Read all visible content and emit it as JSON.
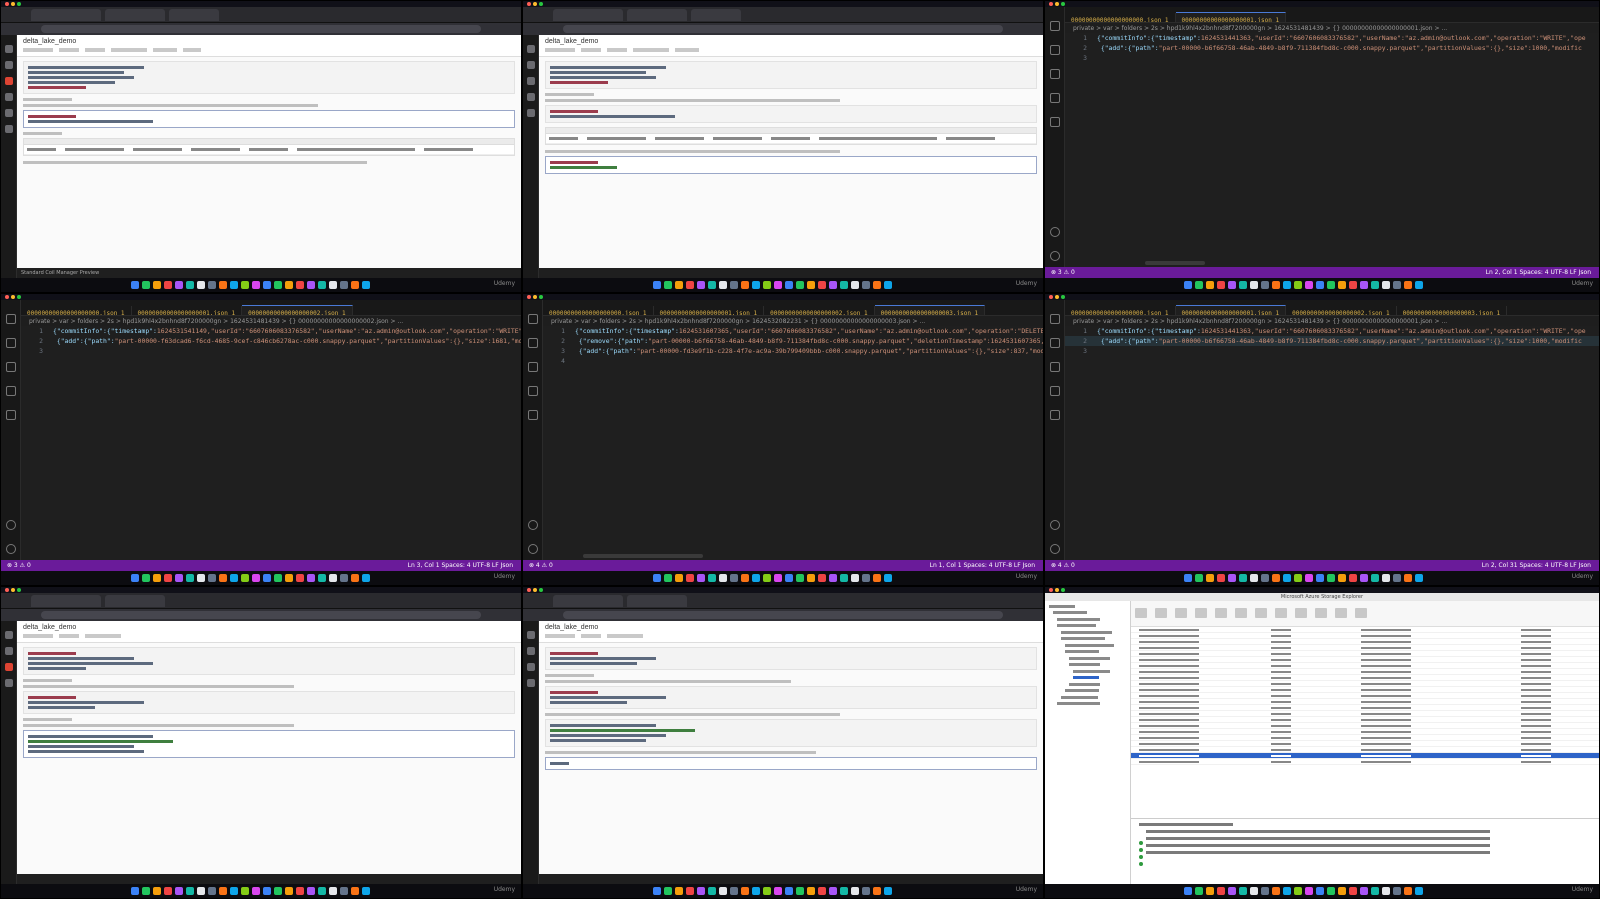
{
  "layout": "3x3 screen recording grid",
  "dock": {
    "label": "Udemy"
  },
  "notebooks": [
    {
      "title": "delta_lake_demo",
      "footer": "Insert cell",
      "status": "Standard Coil Manager Preview"
    },
    {
      "title": "delta_lake_demo",
      "footer": "Insert cell"
    },
    {
      "title": "delta_lake_demo",
      "footer": "Insert cell"
    },
    {
      "title": "delta_lake_demo",
      "footer": "Insert cell"
    }
  ],
  "editors": [
    {
      "tabs": [
        "00000000000000000000.json 1",
        "00000000000000000001.json 1"
      ],
      "selected": 1,
      "breadcrumb": "private > var > folders > 2s > hpd1k9hl4x2bnhnd8f7200000gn > 1624531481439 > {} 00000000000000000001.json > ...",
      "lines": [
        {
          "n": "1",
          "k": "{\"commitInfo\":{\"timestamp\":",
          "s": "1624531441363,\"userId\":\"6607606083376582\",\"userName\":\"az.admin@outlook.com\",\"operation\":\"WRITE\",\"ope"
        },
        {
          "n": "2",
          "k": " {\"add\":{\"path\":",
          "s": "\"part-00000-b6f66758-46ab-4849-b8f9-711384fbd8c-c000.snappy.parquet\",\"partitionValues\":{},\"size\":1000,\"modific"
        },
        {
          "n": "3",
          "k": "",
          "s": ""
        }
      ],
      "status_left": "⊗ 3 ⚠ 0",
      "status_right": "Ln 2, Col 1   Spaces: 4   UTF-8   LF   Json"
    },
    {
      "tabs": [
        "00000000000000000000.json 1",
        "00000000000000000001.json 1",
        "00000000000000000002.json 1"
      ],
      "selected": 2,
      "breadcrumb": "private > var > folders > 2s > hpd1k9hl4x2bnhnd8f7200000gn > 1624531481439 > {} 00000000000000000002.json > ...",
      "lines": [
        {
          "n": "1",
          "k": "{\"commitInfo\":{\"timestamp\":",
          "s": "1624531541149,\"userId\":\"6607606083376582\",\"userName\":\"az.admin@outlook.com\",\"operation\":\"WRITE\",\"oper"
        },
        {
          "n": "2",
          "k": " {\"add\":{\"path\":",
          "s": "\"part-00000-f63dcad6-f6cd-4685-9cef-c846cb6278ac-c000.snappy.parquet\",\"partitionValues\":{},\"size\":1681,\"modific"
        },
        {
          "n": "3",
          "k": "",
          "s": ""
        }
      ],
      "status_left": "⊗ 3 ⚠ 0",
      "status_right": "Ln 3, Col 1   Spaces: 4   UTF-8   LF   Json"
    },
    {
      "tabs": [
        "00000000000000000000.json 1",
        "00000000000000000001.json 1",
        "00000000000000000002.json 1",
        "00000000000000000003.json 1"
      ],
      "selected": 3,
      "breadcrumb": "private > var > folders > 2s > hpd1k9hl4x2bnhnd8f7200000gn > 1624532082231 > {} 00000000000000000003.json > ...",
      "lines": [
        {
          "n": "1",
          "k": "{\"commitInfo\":{\"timestamp\":",
          "s": "1624531607365,\"userId\":\"6607606083376582\",\"userName\":\"az.admin@outlook.com\",\"operation\":\"DELETE\",\"oper"
        },
        {
          "n": "2",
          "k": " {\"remove\":{\"path\":",
          "s": "\"part-00000-b6f66758-46ab-4849-b8f9-711384fbd8c-c000.snappy.parquet\",\"deletionTimestamp\":1624531607365,\"dat"
        },
        {
          "n": "3",
          "k": " {\"add\":{\"path\":",
          "s": "\"part-00000-fd3e9f1b-c228-4f7e-ac9a-39b799409bbb-c000.snappy.parquet\",\"partitionValues\":{},\"size\":837,\"modifica"
        },
        {
          "n": "4",
          "k": "",
          "s": ""
        }
      ],
      "status_left": "⊗ 4 ⚠ 0",
      "status_right": "Ln 1, Col 1   Spaces: 4   UTF-8   LF   Json"
    },
    {
      "tabs": [
        "00000000000000000000.json 1",
        "00000000000000000001.json 1",
        "00000000000000000002.json 1",
        "00000000000000000003.json 1"
      ],
      "selected": 1,
      "breadcrumb": "private > var > folders > 2s > hpd1k9hl4x2bnhnd8f7200000gn > 1624531481439 > {} 00000000000000000001.json > ...",
      "lines": [
        {
          "n": "1",
          "k": "{\"commitInfo\":{\"timestamp\":",
          "s": "1624531441363,\"userId\":\"6607606083376582\",\"userName\":\"az.admin@outlook.com\",\"operation\":\"WRITE\",\"ope"
        },
        {
          "n": "2",
          "k": " {\"add\":{\"path\":",
          "s": "\"part-00000-b6f66758-46ab-4849-b8f9-711384fbd8c-c000.snappy.parquet\",\"partitionValues\":{},\"size\":1000,\"modific"
        },
        {
          "n": "3",
          "k": "",
          "s": ""
        }
      ],
      "status_left": "⊗ 4 ⚠ 0",
      "status_right": "Ln 2, Col 31   Spaces: 4   UTF-8   LF   Json"
    }
  ],
  "storage_explorer": {
    "title": "Microsoft Azure Storage Explorer"
  }
}
